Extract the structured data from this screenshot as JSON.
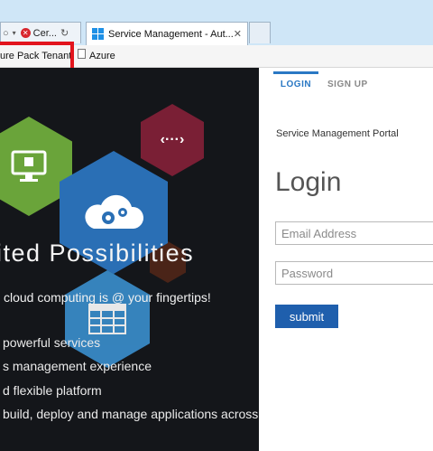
{
  "browser": {
    "tabs": [
      {
        "label": "Cer..."
      },
      {
        "label": "Service Management - Aut..."
      }
    ],
    "favorites": [
      {
        "label": "ure Pack Tenant"
      },
      {
        "label": "Azure"
      }
    ]
  },
  "hero": {
    "title": "ited Possibilities",
    "subtitle": "cloud computing is @ your fingertips!",
    "bullets": [
      "powerful services",
      "s management experience",
      "d flexible platform",
      "build, deploy and manage applications across"
    ]
  },
  "login": {
    "tabs": [
      {
        "label": "LOGIN"
      },
      {
        "label": "SIGN UP"
      }
    ],
    "portal_title": "Service Management Portal",
    "heading": "Login",
    "email_placeholder": "Email Address",
    "password_placeholder": "Password",
    "submit_label": "submit"
  },
  "colors": {
    "accent": "#2a78c4",
    "submit": "#1f5fad",
    "highlight": "#e2141c",
    "hex_green": "#6aa43a",
    "hex_blue": "#2a6fb5",
    "hex_wine": "#7a1f35",
    "hex_lightblue": "#3a8fcf"
  }
}
